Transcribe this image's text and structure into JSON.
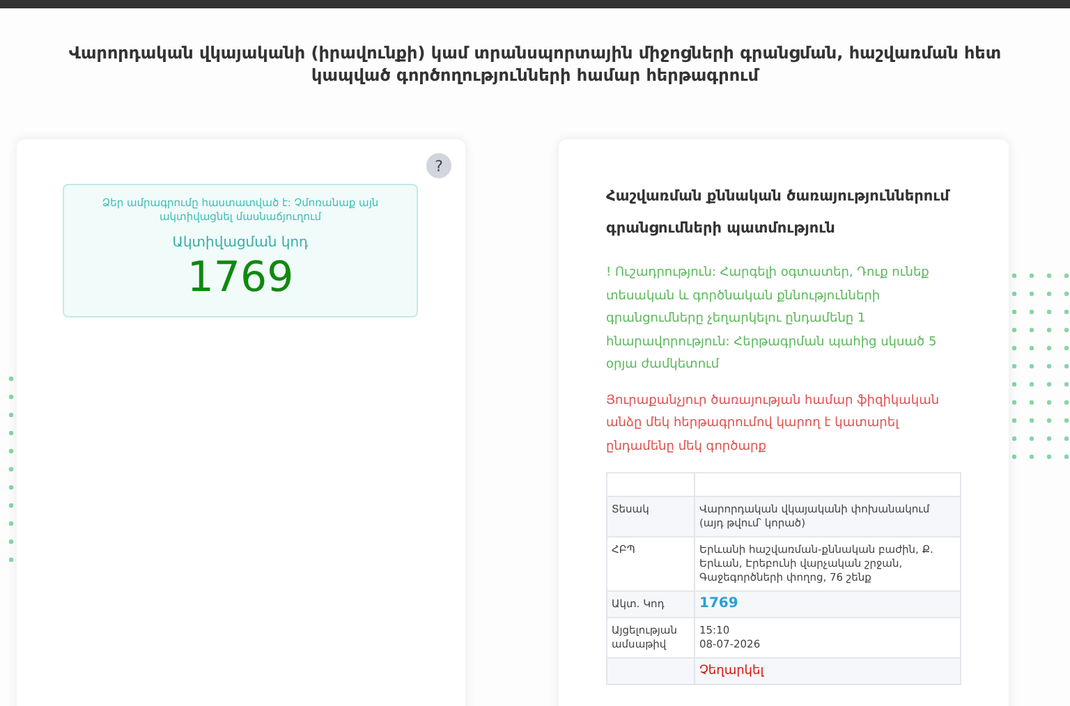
{
  "page_title": "Վարորդական վկայականի (իրավունքի) կամ տրանսպորտային միջոցների գրանցման, հաշվառման հետ կապված գործողությունների համար հերթագրում",
  "confirmation": {
    "help_button": "?",
    "message": "Ձեր ամրագրումը հաստատված է: Չմոռանաք այն ակտիվացնել մասնաճյուղում",
    "code_label": "Ակտիվացման կոդ",
    "code": "1769"
  },
  "history": {
    "title": "Հաշվառման քննական ծառայություններում գրանցումների պատմություն",
    "notices": [
      {
        "kind": "warning",
        "text": "! Ուշադրություն: Հարգելի օգտատեր, Դուք ունեք տեսական և գործնական քննությունների գրանցումները չեղարկելու ընդամենը 1 հնարավորություն: Հերթագրման պահից սկսած 5 օրյա ժամկետում"
      },
      {
        "kind": "alert",
        "text": "Յուրաքանչյուր ծառայության համար ֆիզիկական անձը մեկ հերթագրումով կարող է կատարել ընդամենը մեկ գործարք"
      }
    ],
    "rows": [
      {
        "kind": "text",
        "label": "Տեսակ",
        "value": "Վարորդական վկայականի փոխանակում (այդ թվում՝ կորած)"
      },
      {
        "kind": "text",
        "label": "ՀԲՊ",
        "value": "Երևանի հաշվառման-քննական բաժին, Ք. Երևան, Էրեբունի վարչական շրջան, Գաջեգործների փողոց, 76 շենք"
      },
      {
        "kind": "code",
        "label": "Ակտ. Կոդ",
        "value": "1769"
      },
      {
        "kind": "lines",
        "label": "Այցելության ամսաթիվ",
        "lines": [
          "15:10",
          "08-07-2026"
        ]
      },
      {
        "kind": "action",
        "value": "Չեղարկել"
      }
    ]
  }
}
